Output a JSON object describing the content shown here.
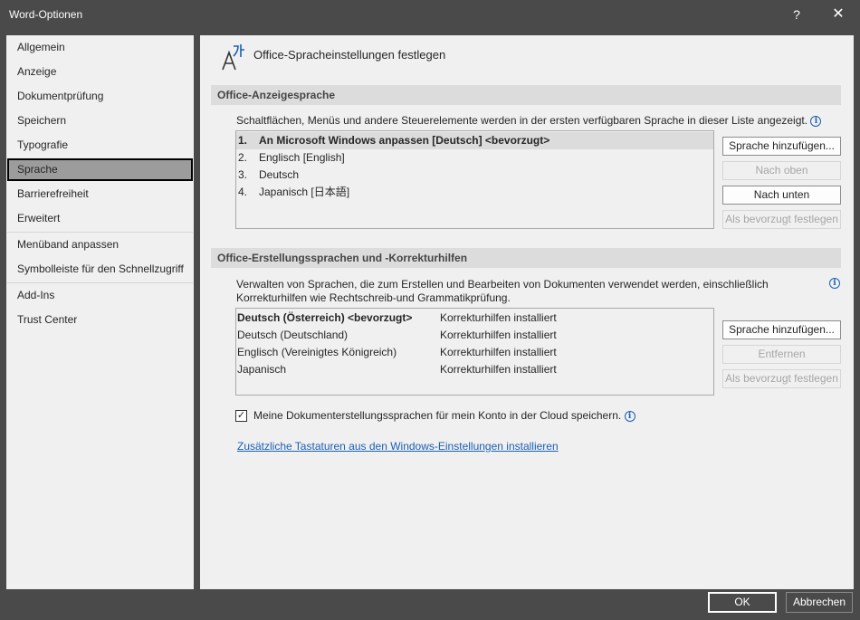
{
  "window": {
    "title": "Word-Optionen",
    "help_label": "?",
    "close_label": "✕"
  },
  "sidebar": {
    "items": [
      {
        "label": "Allgemein"
      },
      {
        "label": "Anzeige"
      },
      {
        "label": "Dokumentprüfung"
      },
      {
        "label": "Speichern"
      },
      {
        "label": "Typografie"
      },
      {
        "label": "Sprache",
        "selected": true
      },
      {
        "label": "Barrierefreiheit"
      },
      {
        "label": "Erweitert"
      },
      {
        "label": "Menüband anpassen"
      },
      {
        "label": "Symbolleiste für den Schnellzugriff"
      },
      {
        "label": "Add-Ins"
      },
      {
        "label": "Trust Center"
      }
    ]
  },
  "main": {
    "header_title": "Office-Spracheinstellungen festlegen",
    "header_icon": "language-icon",
    "display": {
      "section_title": "Office-Anzeigesprache",
      "description": "Schaltflächen, Menüs und andere Steuerelemente werden in der ersten verfügbaren Sprache in dieser Liste angezeigt.",
      "languages": [
        {
          "num": "1.",
          "label": "An Microsoft Windows anpassen [Deutsch] <bevorzugt>"
        },
        {
          "num": "2.",
          "label": "Englisch [English]"
        },
        {
          "num": "3.",
          "label": "Deutsch"
        },
        {
          "num": "4.",
          "label": "Japanisch [日本語]"
        }
      ],
      "buttons": {
        "add": "Sprache hinzufügen...",
        "move_up": "Nach oben",
        "move_down": "Nach unten",
        "set_preferred": "Als bevorzugt festlegen"
      }
    },
    "authoring": {
      "section_title": "Office-Erstellungssprachen und -Korrekturhilfen",
      "description_line1": "Verwalten von Sprachen, die zum Erstellen und Bearbeiten von Dokumenten verwendet werden, einschließlich",
      "description_line2": "Korrekturhilfen wie Rechtschreib-und Grammatikprüfung.",
      "languages": [
        {
          "name": "Deutsch (Österreich) <bevorzugt>",
          "status": "Korrekturhilfen installiert"
        },
        {
          "name": "Deutsch (Deutschland)",
          "status": "Korrekturhilfen installiert"
        },
        {
          "name": "Englisch (Vereinigtes Königreich)",
          "status": "Korrekturhilfen installiert"
        },
        {
          "name": "Japanisch",
          "status": "Korrekturhilfen installiert"
        }
      ],
      "buttons": {
        "add": "Sprache hinzufügen...",
        "remove": "Entfernen",
        "set_preferred": "Als bevorzugt festlegen"
      }
    },
    "cloud_checkbox_label": "Meine Dokumenterstellungssprachen für mein Konto in der Cloud speichern.",
    "cloud_checkbox_checked": true,
    "keyboards_link": "Zusätzliche Tastaturen aus den Windows-Einstellungen installieren"
  },
  "footer": {
    "ok": "OK",
    "cancel": "Abbrechen"
  },
  "colors": {
    "chrome": "#4a4a4a",
    "panel": "#f0f0f0",
    "selected_nav": "#9c9c9c",
    "link": "#1a5fb4"
  }
}
